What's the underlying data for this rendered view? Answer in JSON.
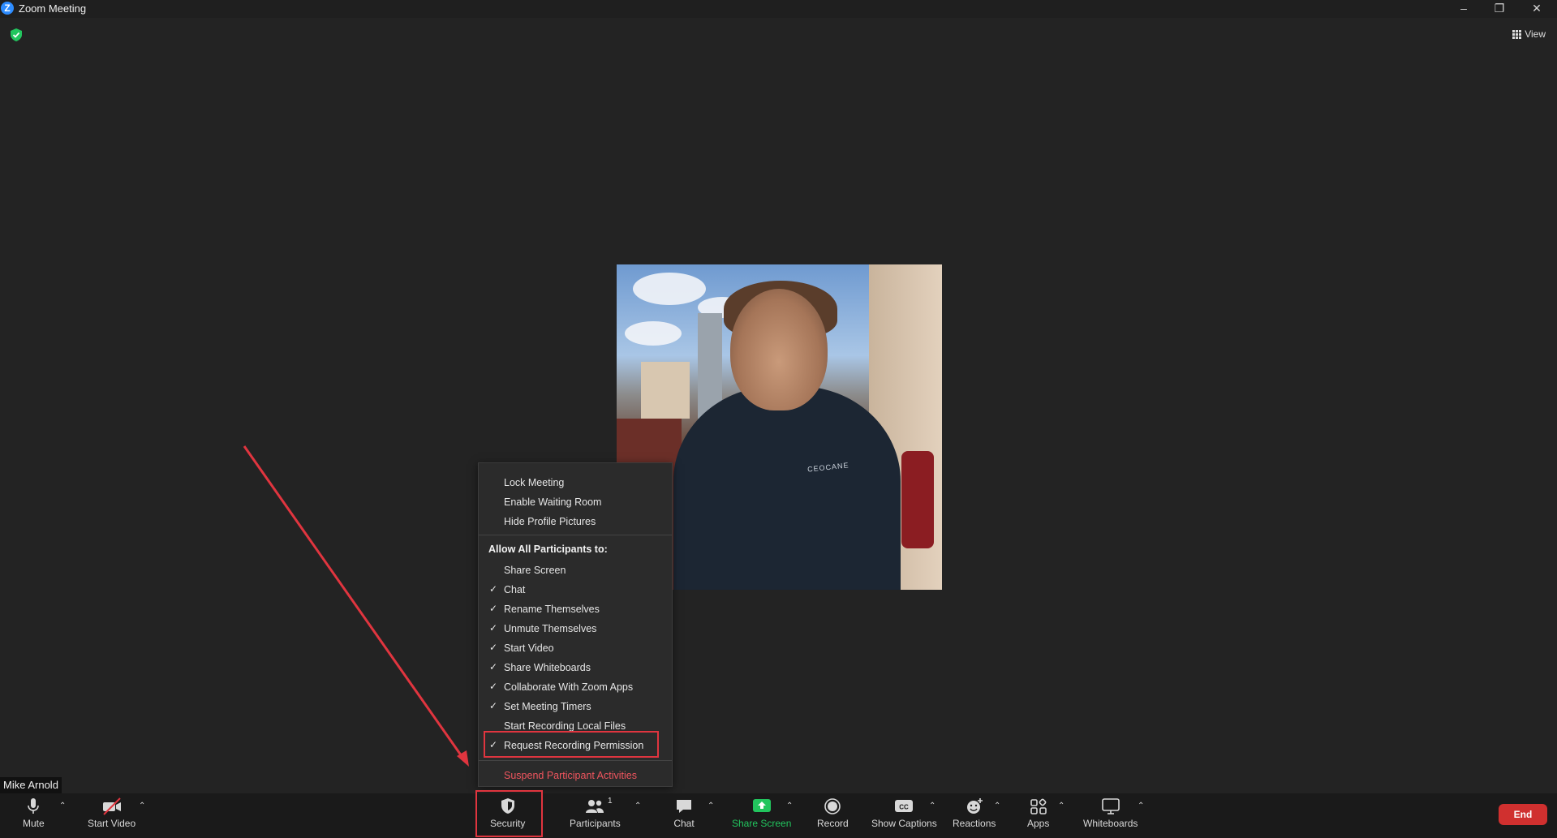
{
  "window": {
    "title": "Zoom Meeting",
    "logo_letter": "Z",
    "controls": [
      "minimize-icon",
      "restore-icon",
      "close-icon"
    ]
  },
  "top_right": {
    "view_label": "View"
  },
  "video": {
    "participant_name": "Mike Arnold",
    "shirt_text": "CEOCANE"
  },
  "security_menu": {
    "top_items": [
      {
        "label": "Lock Meeting",
        "checked": false
      },
      {
        "label": "Enable Waiting Room",
        "checked": false
      },
      {
        "label": "Hide Profile Pictures",
        "checked": false
      }
    ],
    "heading": "Allow All Participants to:",
    "allow_items": [
      {
        "label": "Share Screen",
        "checked": false
      },
      {
        "label": "Chat",
        "checked": true
      },
      {
        "label": "Rename Themselves",
        "checked": true
      },
      {
        "label": "Unmute Themselves",
        "checked": true
      },
      {
        "label": "Start Video",
        "checked": true
      },
      {
        "label": "Share Whiteboards",
        "checked": true
      },
      {
        "label": "Collaborate With Zoom Apps",
        "checked": true
      },
      {
        "label": "Set Meeting Timers",
        "checked": true
      },
      {
        "label": "Start Recording Local Files",
        "checked": false
      },
      {
        "label": "Request Recording Permission",
        "checked": true
      }
    ],
    "suspend_label": "Suspend Participant Activities"
  },
  "toolbar": {
    "mute": "Mute",
    "start_video": "Start Video",
    "security": "Security",
    "participants": "Participants",
    "participants_count": "1",
    "chat": "Chat",
    "share_screen": "Share Screen",
    "record": "Record",
    "show_captions": "Show Captions",
    "reactions": "Reactions",
    "apps": "Apps",
    "whiteboards": "Whiteboards",
    "end": "End"
  },
  "colors": {
    "background": "#232323",
    "annotation_red": "#e0353f",
    "share_green": "#22c55e",
    "end_red": "#d0302f"
  }
}
